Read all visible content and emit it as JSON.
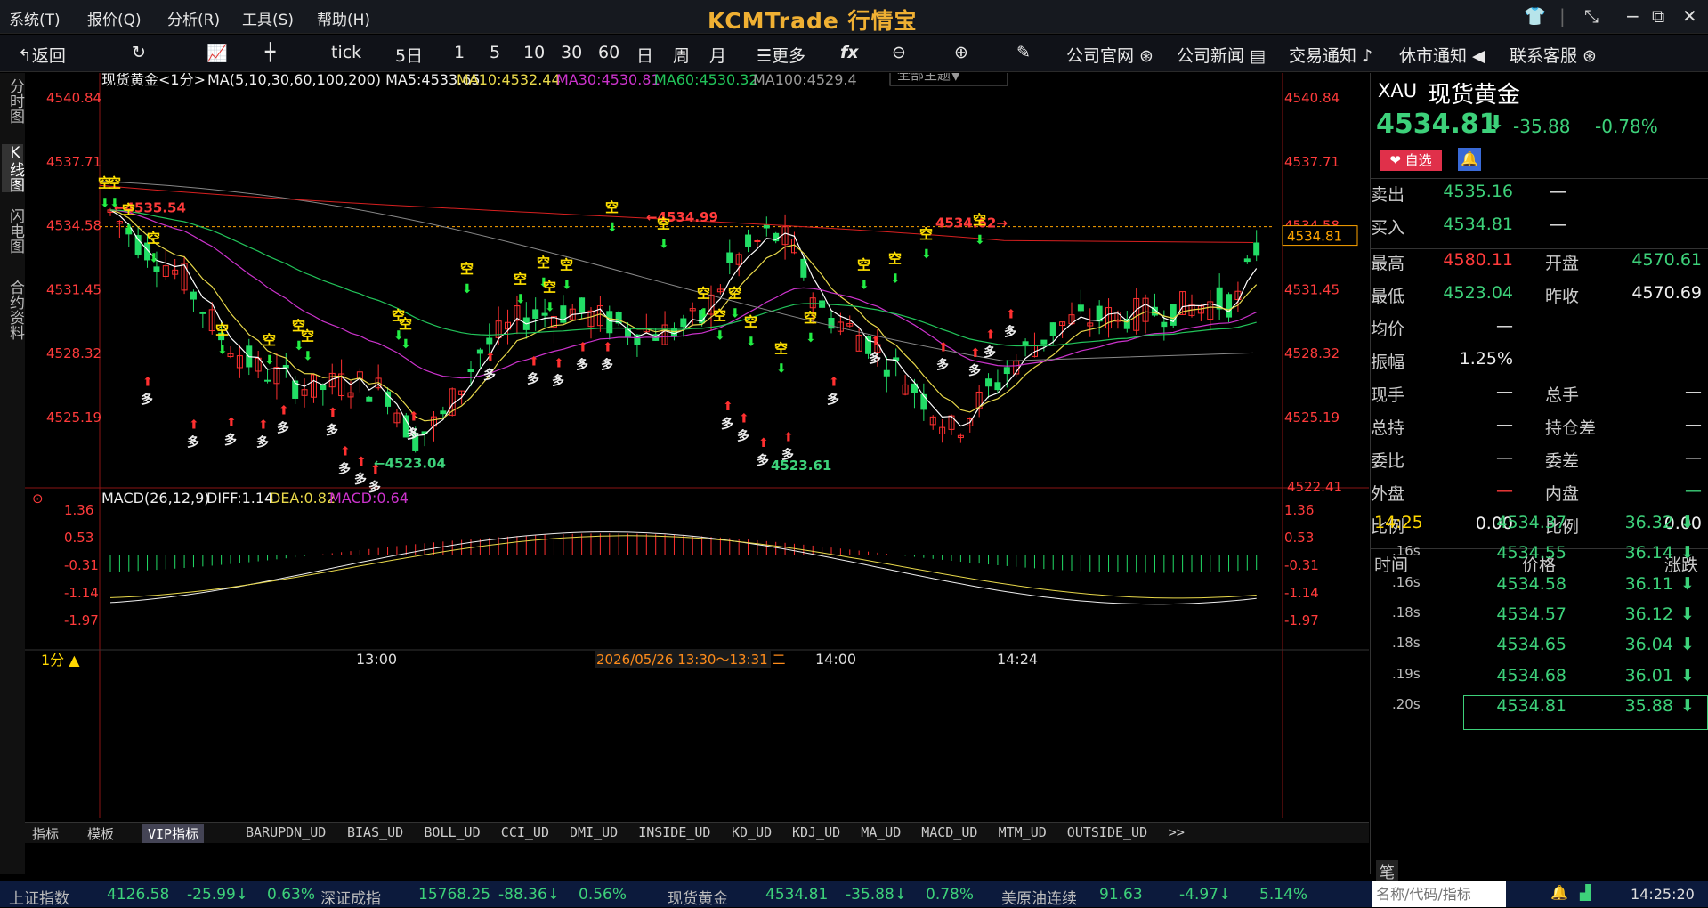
{
  "menu": {
    "items": [
      "系统(T)",
      "报价(Q)",
      "分析(R)",
      "工具(S)",
      "帮助(H)"
    ],
    "brand": "KCMTrade 行情宝"
  },
  "toolbar": {
    "back": "返回",
    "periods": [
      "tick",
      "5日",
      "1",
      "5",
      "10",
      "30",
      "60",
      "日",
      "周",
      "月"
    ],
    "more": "更多",
    "links": [
      "公司官网",
      "公司新闻",
      "交易通知",
      "休市通知",
      "联系客服"
    ]
  },
  "left_tabs": [
    "分时图",
    "K线图",
    "闪电图",
    "合约资料"
  ],
  "chart": {
    "header": "现货黄金<1分>",
    "ma_text": "MA(5,10,30,60,100,200) MA5:4533.65",
    "ma10": "MA10:4532.44",
    "ma30": "MA30:4530.81",
    "ma60": "MA60:4530.32",
    "ma100": "MA100:4529.4",
    "theme_btn": "全部主题▼",
    "price_ticks": [
      "4540.84",
      "4537.71",
      "4534.58",
      "4531.45",
      "4528.32",
      "4525.19"
    ],
    "current_price_tag": "4534.81",
    "bottom_price_tag": "4522.41",
    "annotations": {
      "high1": "4535.54",
      "high2": "4534.99",
      "high3": "4534.62",
      "low1": "4523.04",
      "low2": "4523.61"
    },
    "sell_mark": "空",
    "buy_mark": "多",
    "macd_header": "MACD(26,12,9)",
    "diff": "DIFF:1.14",
    "dea": "DEA:0.82",
    "macd": "MACD:0.64",
    "macd_ticks": [
      "1.36",
      "0.53",
      "-0.31",
      "-1.14",
      "-1.97"
    ],
    "time_ticks": [
      "13:00",
      "14:00",
      "14:24"
    ],
    "period_label": "1分 ▲",
    "range_label": "2026/05/26 13:30～13:31 二",
    "colors": {
      "up": "#ff3030",
      "down": "#22dd66",
      "ma5": "#ffffff",
      "ma10": "#e8d84a",
      "ma30": "#cc33cc",
      "ma60": "#22c45a",
      "ma100": "#888888",
      "ma200": "#d82020"
    }
  },
  "bottom_tabs": [
    "指标",
    "模板",
    "VIP指标",
    "BARUPDN_UD",
    "BIAS_UD",
    "BOLL_UD",
    "CCI_UD",
    "DMI_UD",
    "INSIDE_UD",
    "KD_UD",
    "KDJ_UD",
    "MA_UD",
    "MACD_UD",
    "MTM_UD",
    "OUTSIDE_UD",
    ">>"
  ],
  "quote": {
    "symbol": "XAU",
    "name": "现货黄金",
    "price": "4534.81",
    "change": "-35.88",
    "pct": "-0.78%",
    "fav": "自选",
    "sell_label": "卖出",
    "sell": "4535.16",
    "buy_label": "买入",
    "buy": "4534.81",
    "dash": "—",
    "high_label": "最高",
    "high": "4580.11",
    "open_label": "开盘",
    "open": "4570.61",
    "low_label": "最低",
    "low": "4523.04",
    "prev_label": "昨收",
    "prev": "4570.69",
    "avg_label": "均价",
    "amp_label": "振幅",
    "amp": "1.25%",
    "vol_label": "现手",
    "tvol_label": "总手",
    "hold_label": "总持",
    "holddiff_label": "持仓差",
    "wb_label": "委比",
    "wc_label": "委差",
    "out_label": "外盘",
    "in_label": "内盘",
    "ratio_label": "比例",
    "ratio1": "0.00",
    "ratio2": "0.00",
    "tick_head": [
      "时间",
      "价格",
      "涨跌"
    ],
    "ticks": [
      {
        "t": "14:25",
        "p": "4534.37",
        "c": "36.32"
      },
      {
        "t": ".16s",
        "p": "4534.55",
        "c": "36.14"
      },
      {
        "t": ".16s",
        "p": "4534.58",
        "c": "36.11"
      },
      {
        "t": ".18s",
        "p": "4534.57",
        "c": "36.12"
      },
      {
        "t": ".18s",
        "p": "4534.65",
        "c": "36.04"
      },
      {
        "t": ".19s",
        "p": "4534.68",
        "c": "36.01"
      },
      {
        "t": ".20s",
        "p": "4534.81",
        "c": "35.88"
      }
    ],
    "note_tab": "笔"
  },
  "ticker": [
    {
      "name": "上证指数",
      "v": "4126.58",
      "c": "-25.99↓",
      "p": "0.63%"
    },
    {
      "name": "深证成指",
      "v": "15768.25",
      "c": "-88.36↓",
      "p": "0.56%"
    },
    {
      "name": "现货黄金",
      "v": "4534.81",
      "c": "-35.88↓",
      "p": "0.78%"
    },
    {
      "name": "美原油连续",
      "v": "91.63",
      "c": "-4.97↓",
      "p": "5.14%"
    }
  ],
  "search_placeholder": "名称/代码/指标",
  "clock": "14:25:20"
}
